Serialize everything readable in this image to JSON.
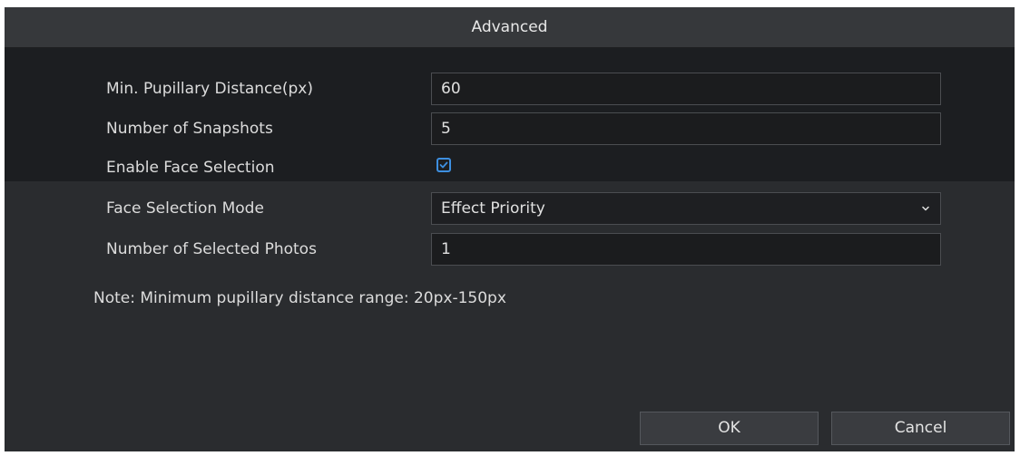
{
  "dialog": {
    "title": "Advanced"
  },
  "form": {
    "min_pupillary_distance": {
      "label": "Min. Pupillary Distance(px)",
      "value": "60"
    },
    "number_of_snapshots": {
      "label": "Number of Snapshots",
      "value": "5"
    },
    "enable_face_selection": {
      "label": "Enable Face Selection",
      "checked": true
    },
    "face_selection_mode": {
      "label": "Face Selection Mode",
      "selected": "Effect Priority",
      "icon": "chevron-down-icon"
    },
    "number_of_selected_photos": {
      "label": "Number of Selected Photos",
      "value": "1"
    },
    "note": "Note: Minimum pupillary distance range: 20px-150px"
  },
  "buttons": {
    "ok": "OK",
    "cancel": "Cancel"
  },
  "colors": {
    "dialog_bg": "#2a2c2f",
    "title_bar_bg": "#36383b",
    "upper_band_bg": "#1c1e21",
    "field_border": "#4b4d51",
    "accent": "#3d8fe0",
    "text": "#dcdcdc"
  }
}
